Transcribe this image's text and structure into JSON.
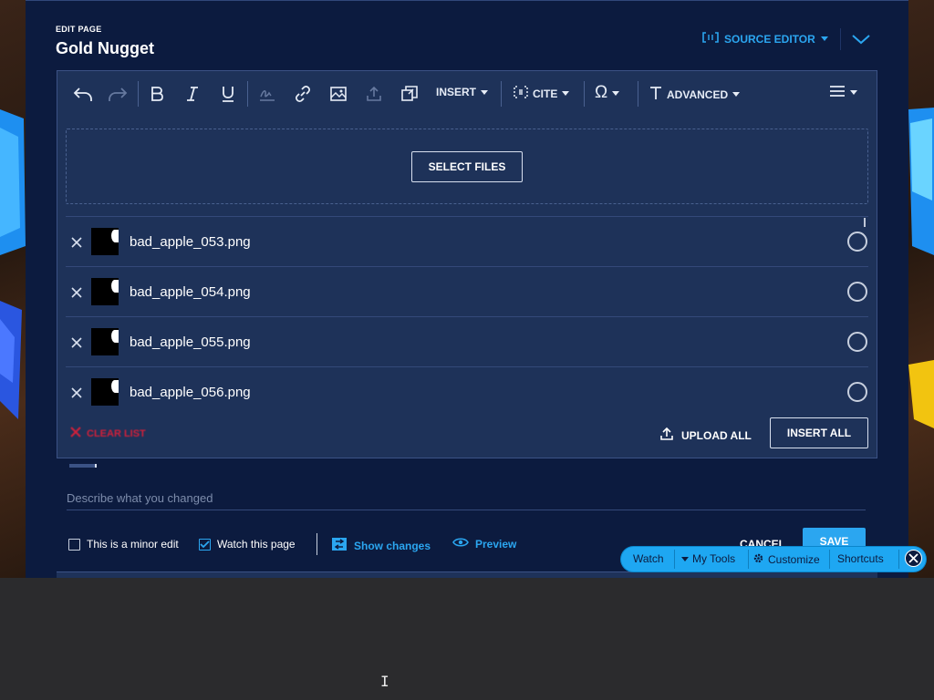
{
  "header": {
    "eyebrow": "EDIT PAGE",
    "title": "Gold Nugget",
    "source_editor_label": "SOURCE EDITOR"
  },
  "toolbar": {
    "insert_label": "INSERT",
    "cite_label": "CITE",
    "advanced_label": "ADVANCED",
    "icons": [
      "undo-icon",
      "redo-icon",
      "bold-icon",
      "italic-icon",
      "underline-icon",
      "signature-icon",
      "link-icon",
      "image-icon",
      "upload-icon",
      "gallery-icon",
      "omega-icon",
      "text-style-icon",
      "menu-icon"
    ]
  },
  "upload": {
    "select_files_label": "SELECT FILES",
    "files": [
      {
        "name": "bad_apple_053.png"
      },
      {
        "name": "bad_apple_054.png"
      },
      {
        "name": "bad_apple_055.png"
      },
      {
        "name": "bad_apple_056.png"
      }
    ],
    "clear_list_label": "CLEAR LIST",
    "upload_all_label": "UPLOAD ALL",
    "insert_all_label": "INSERT ALL"
  },
  "summary": {
    "placeholder": "Describe what you changed",
    "value": ""
  },
  "options": {
    "minor_edit_label": "This is a minor edit",
    "minor_edit_checked": false,
    "watch_label": "Watch this page",
    "watch_checked": true,
    "show_changes_label": "Show changes",
    "preview_label": "Preview",
    "cancel_label": "CANCEL",
    "save_label": "SAVE"
  },
  "floating_toolbar": {
    "watch_label": "Watch",
    "my_tools_label": "My Tools",
    "customize_label": "Customize",
    "shortcuts_label": "Shortcuts"
  },
  "colors": {
    "panel_bg": "#0c1b3f",
    "editor_bg": "#1e3259",
    "accent": "#2ba6f0",
    "danger": "#d0203a"
  }
}
